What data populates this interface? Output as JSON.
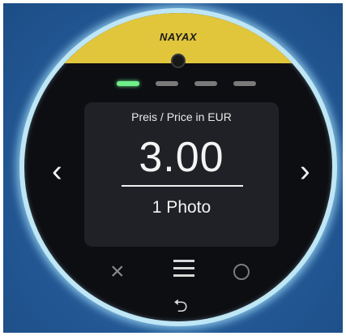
{
  "device": {
    "brand": "NAYAX"
  },
  "progress": {
    "total_steps": 4,
    "active_step": 1
  },
  "screen": {
    "price_label": "Preis / Price in EUR",
    "price_value": "3.00",
    "product_label": "1 Photo"
  },
  "controls": {
    "prev_icon": "chevron-left-icon",
    "next_icon": "chevron-right-icon",
    "cancel_icon": "x-icon",
    "menu_icon": "menu-icon",
    "ok_icon": "circle-icon",
    "back_icon": "return-arrow-icon"
  },
  "colors": {
    "brand_band": "#e1c63c",
    "active_indicator": "#6ff08a",
    "ring_glow": "#bfe6f5",
    "screen_bg": "#1f2126"
  }
}
